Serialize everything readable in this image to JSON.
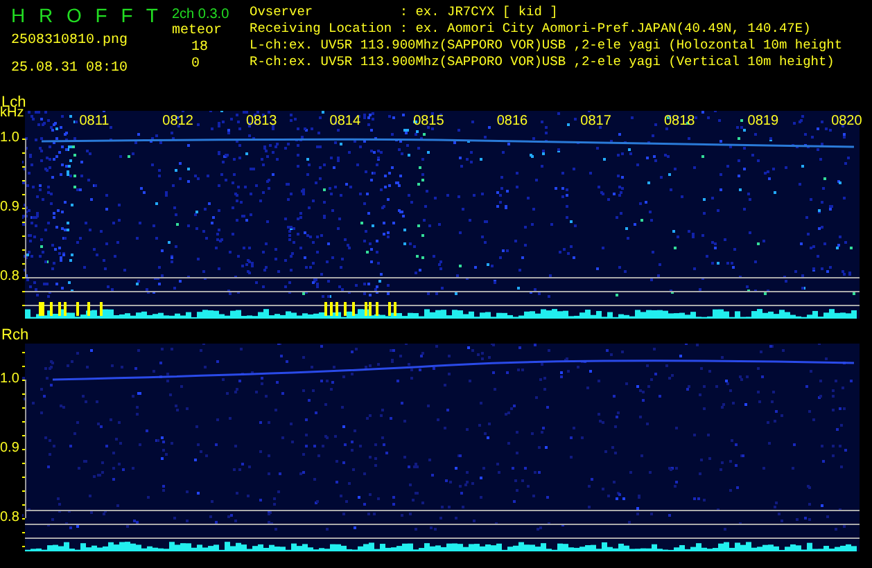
{
  "app": {
    "title": "H R O F F T",
    "version": "2ch 0.3.0",
    "filename": "2508310810.png",
    "datetime": "25.08.31 08:10"
  },
  "meteor": {
    "label": "meteor",
    "counts": [
      "18",
      "0"
    ]
  },
  "info": [
    "Ovserver           : ex. JR7CYX [ kid ]",
    "Receiving Location : ex. Aomori City Aomori-Pref.JAPAN(40.49N, 140.47E)",
    "L-ch:ex. UV5R 113.900Mhz(SAPPORO VOR)USB ,2-ele yagi (Holozontal 10m height",
    "R-ch:ex. UV5R 113.900Mhz(SAPPORO VOR)USB ,2-ele yagi (Vertical 10m height)"
  ],
  "panels": [
    {
      "label": "Lch",
      "unit": "kHz",
      "time_labels": [
        "0811",
        "0812",
        "0813",
        "0814",
        "0815",
        "0816",
        "0817",
        "0818",
        "0819",
        "0820"
      ],
      "y_labels": [
        "1.0",
        "0.9",
        "0.8"
      ]
    },
    {
      "label": "Rch",
      "y_labels": [
        "1.0",
        "0.9",
        "0.8"
      ]
    }
  ]
}
